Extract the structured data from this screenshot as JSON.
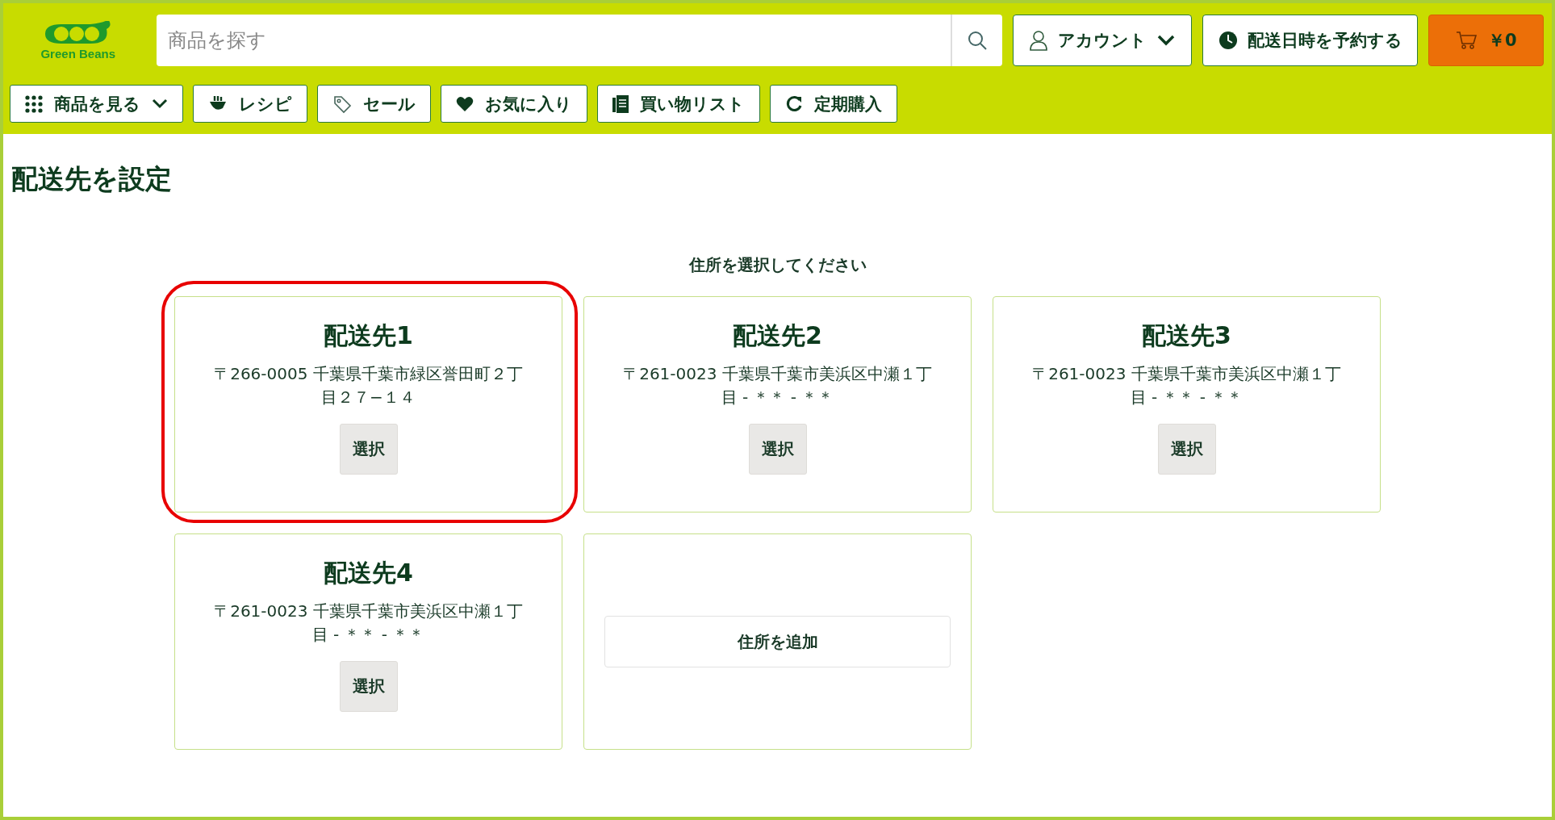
{
  "header": {
    "logo_text": "Green Beans",
    "search": {
      "placeholder": "商品を探す"
    },
    "account": {
      "label": "アカウント"
    },
    "delivery_booking": {
      "label": "配送日時を予約する"
    },
    "cart": {
      "amount": "￥0"
    }
  },
  "nav": [
    {
      "kind": "grid",
      "label": "商品を見る",
      "dropdown": true
    },
    {
      "kind": "hand",
      "label": "レシピ",
      "dropdown": false
    },
    {
      "kind": "tag",
      "label": "セール",
      "dropdown": false
    },
    {
      "kind": "heart",
      "label": "お気に入り",
      "dropdown": false
    },
    {
      "kind": "list",
      "label": "買い物リスト",
      "dropdown": false
    },
    {
      "kind": "refresh",
      "label": "定期購入",
      "dropdown": false
    }
  ],
  "page_title": "配送先を設定",
  "prompt": "住所を選択してください",
  "addresses": [
    {
      "name": "配送先1",
      "address": "〒266-0005 千葉県千葉市緑区誉田町２丁目２７−１４",
      "button": "選択",
      "highlighted": true
    },
    {
      "name": "配送先2",
      "address": "〒261-0023 千葉県千葉市美浜区中瀬１丁目 - ＊＊ - ＊＊",
      "button": "選択",
      "highlighted": false
    },
    {
      "name": "配送先3",
      "address": "〒261-0023 千葉県千葉市美浜区中瀬１丁目 - ＊＊ - ＊＊",
      "button": "選択",
      "highlighted": false
    },
    {
      "name": "配送先4",
      "address": "〒261-0023 千葉県千葉市美浜区中瀬１丁目 - ＊＊ - ＊＊",
      "button": "選択",
      "highlighted": false
    }
  ],
  "add_address": {
    "label": "住所を追加"
  }
}
